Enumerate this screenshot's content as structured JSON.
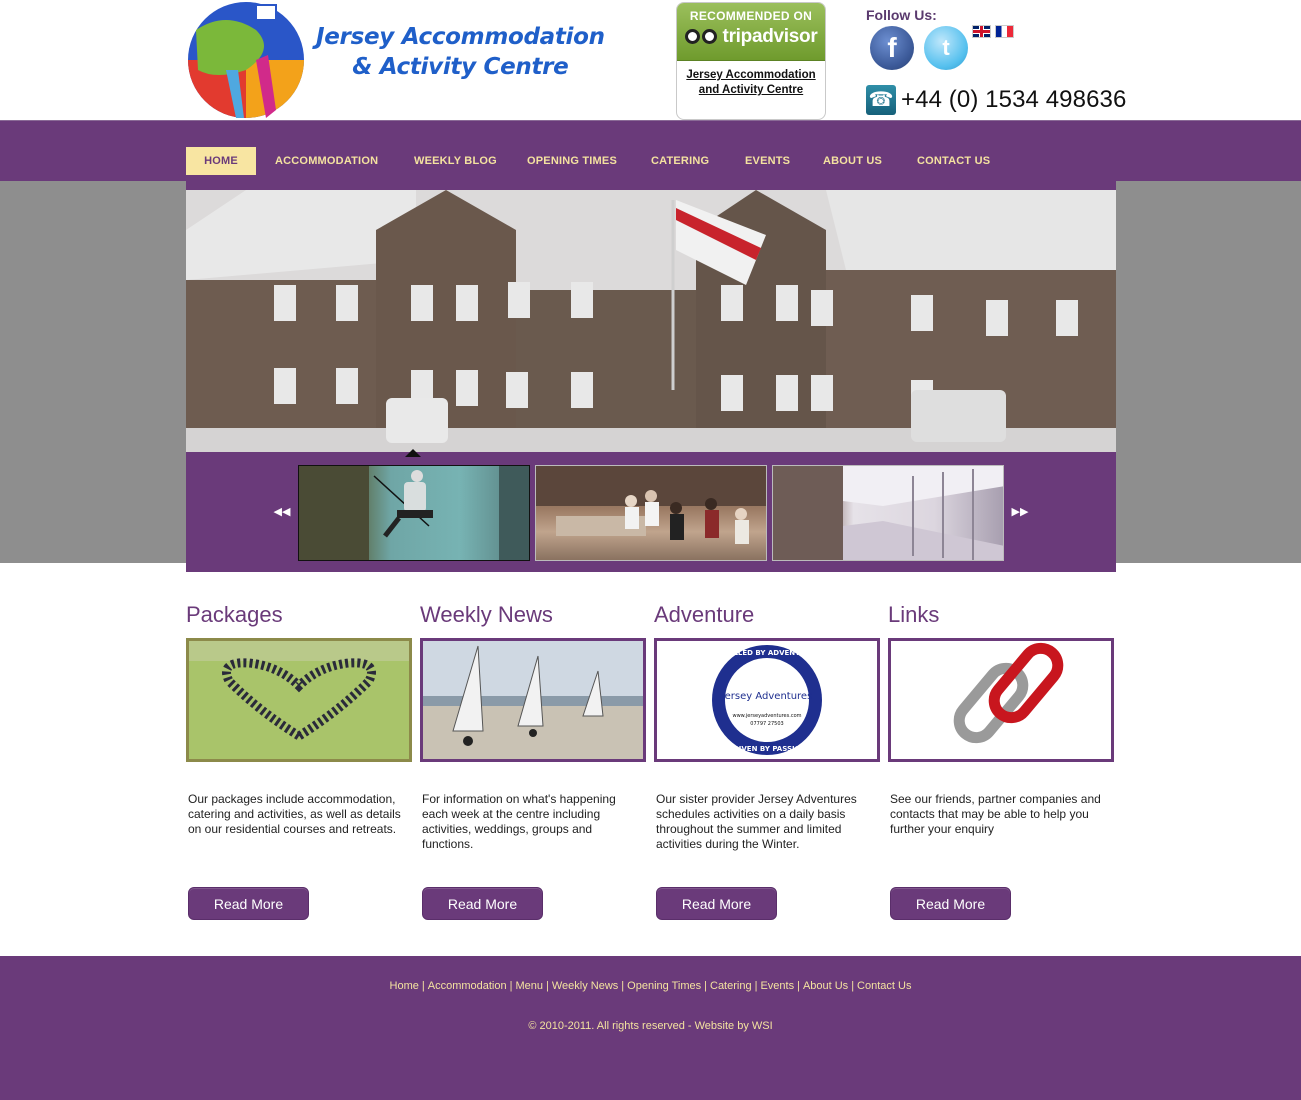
{
  "header": {
    "title_line1": "Jersey Accommodation",
    "title_line2": "& Activity Centre",
    "tripadvisor": {
      "recommended": "RECOMMENDED ON",
      "brand": "tripadvisor",
      "link_text": "Jersey Accommodation and Activity Centre"
    },
    "follow_label": "Follow Us:",
    "phone": "+44 (0) 1534 498636"
  },
  "nav": {
    "items": [
      {
        "label": "HOME"
      },
      {
        "label": "ACCOMMODATION"
      },
      {
        "label": "WEEKLY BLOG"
      },
      {
        "label": "OPENING TIMES"
      },
      {
        "label": "CATERING"
      },
      {
        "label": "EVENTS"
      },
      {
        "label": "ABOUT US"
      },
      {
        "label": "CONTACT US"
      }
    ]
  },
  "slider": {
    "prev_icon": "prev-arrow-icon",
    "next_icon": "next-arrow-icon"
  },
  "columns": [
    {
      "heading": "Packages",
      "text": "Our packages include accommodation, catering and activities, as well as details on our residential courses and retreats.",
      "button": "Read More"
    },
    {
      "heading": "Weekly News",
      "text": "For information on what's happening each week at the centre including activities, weddings, groups and functions.",
      "button": "Read More"
    },
    {
      "heading": "Adventure",
      "text": "Our sister provider Jersey Adventures schedules activities on a daily basis throughout the summer and limited activities during the Winter.",
      "button": "Read More",
      "logo": {
        "top_ring": "FUELLED BY ADVENTURE",
        "bottom_ring": "DRIVEN BY PASSION",
        "name": "Jersey Adventures",
        "url": "www.jerseyadventures.com",
        "phone": "07797 27503"
      }
    },
    {
      "heading": "Links",
      "text": "See our friends, partner companies and contacts that may be able to help you further your enquiry",
      "button": "Read More"
    }
  ],
  "footer": {
    "links": [
      "Home",
      "Accommodation",
      "Menu",
      "Weekly News",
      "Opening Times",
      "Catering",
      "Events",
      "About Us",
      "Contact Us"
    ],
    "separator": "|",
    "copyright": "© 2010-2011. All rights reserved - Website by WSI"
  },
  "colors": {
    "brand_purple": "#6a3a7a",
    "nav_text": "#f4e2a0",
    "nav_active_bg": "#f8e5a2",
    "title_blue": "#1f5fc9"
  }
}
